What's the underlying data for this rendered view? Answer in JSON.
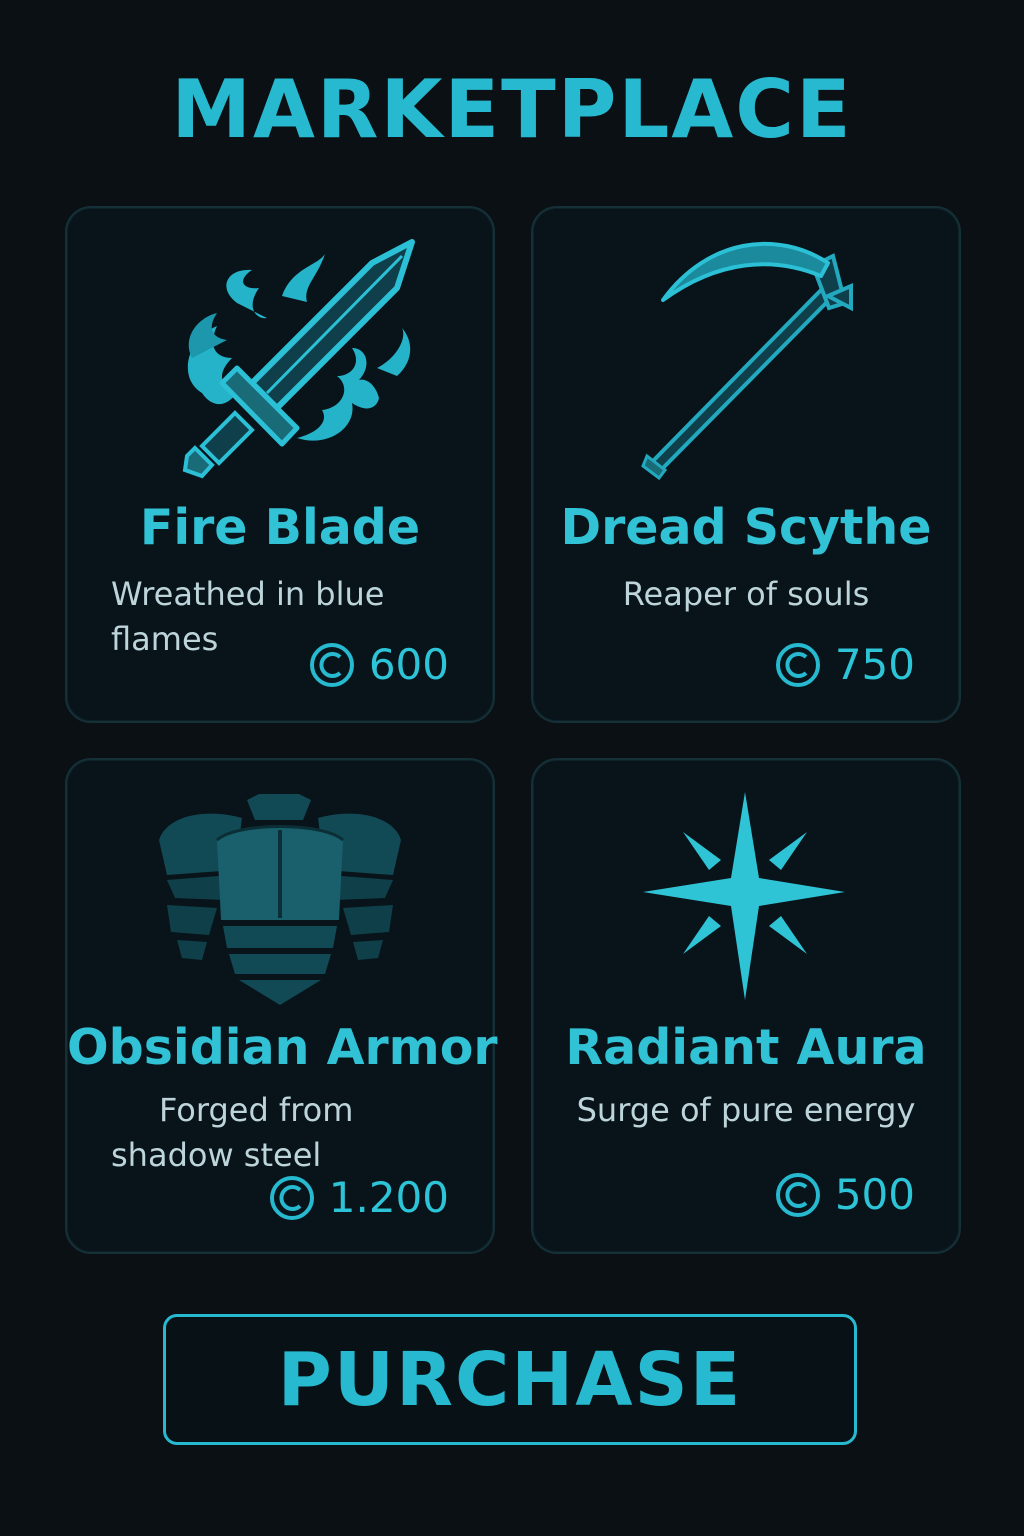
{
  "page": {
    "title": "MARKETPLACE"
  },
  "items": [
    {
      "name": "Fire Blade",
      "description": "Wreathed in blue flames",
      "desc_line1": "Wreathed in blue",
      "desc_line2": "flames",
      "price": "600",
      "icon": "flaming-sword-icon"
    },
    {
      "name": "Dread Scythe",
      "description": "Reaper of souls",
      "price": "750",
      "icon": "scythe-icon"
    },
    {
      "name": "Obsidian Armor",
      "description": "Forged from shadow steel",
      "desc_line1": "Forged from",
      "desc_line2": "shadow steel",
      "price": "1.200",
      "icon": "chest-armor-icon"
    },
    {
      "name": "Radiant Aura",
      "description": "Surge of pure energy",
      "price": "500",
      "icon": "star-sparkle-icon"
    }
  ],
  "currency_icon": "coin-icon",
  "purchase_button": {
    "label": "PURCHASE"
  },
  "colors": {
    "background": "#0a1013",
    "accent": "#27b9cf",
    "card_bg": "#08141a",
    "card_border": "#163038",
    "text_light": "#bcd4da"
  }
}
